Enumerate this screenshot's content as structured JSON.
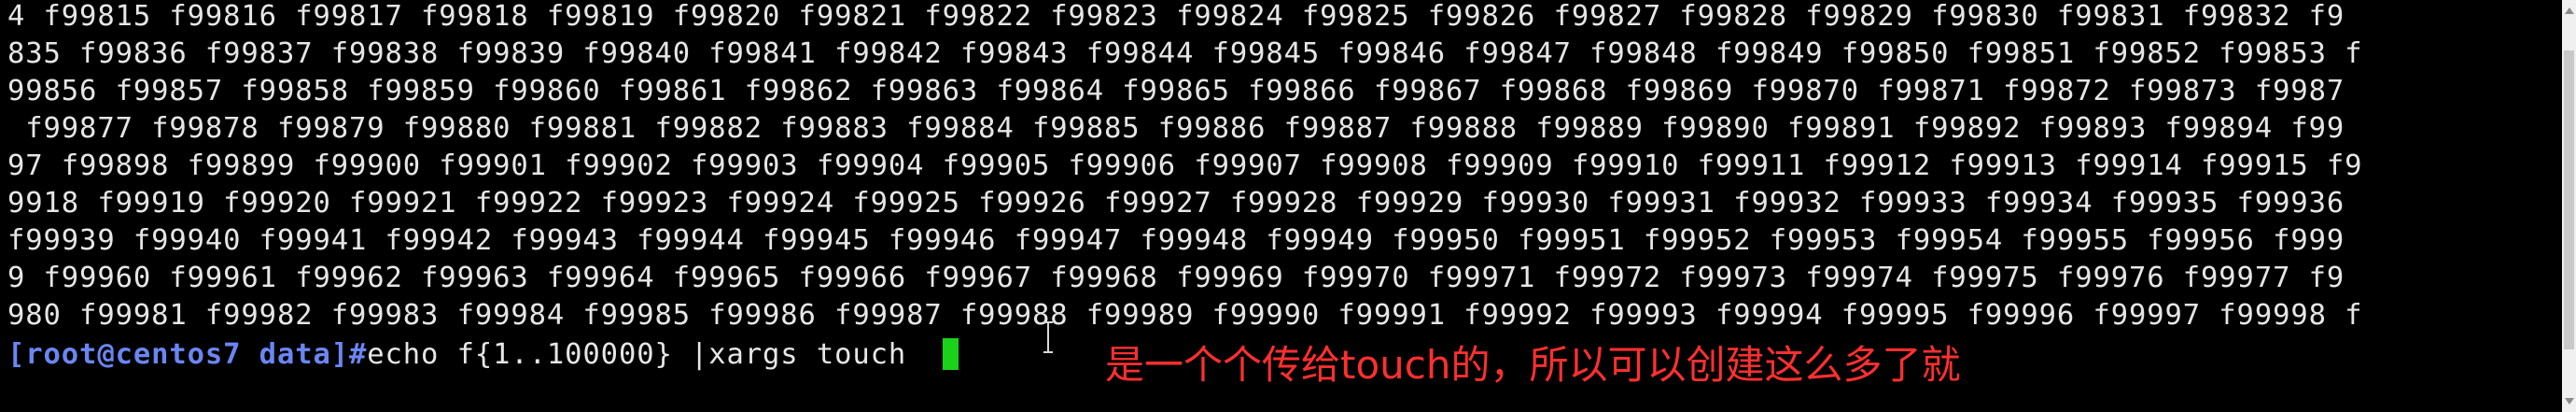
{
  "terminal": {
    "output_lines": [
      "4 f99815 f99816 f99817 f99818 f99819 f99820 f99821 f99822 f99823 f99824 f99825 f99826 f99827 f99828 f99829 f99830 f99831 f99832 f9",
      "835 f99836 f99837 f99838 f99839 f99840 f99841 f99842 f99843 f99844 f99845 f99846 f99847 f99848 f99849 f99850 f99851 f99852 f99853 f",
      "99856 f99857 f99858 f99859 f99860 f99861 f99862 f99863 f99864 f99865 f99866 f99867 f99868 f99869 f99870 f99871 f99872 f99873 f9987",
      " f99877 f99878 f99879 f99880 f99881 f99882 f99883 f99884 f99885 f99886 f99887 f99888 f99889 f99890 f99891 f99892 f99893 f99894 f99",
      "97 f99898 f99899 f99900 f99901 f99902 f99903 f99904 f99905 f99906 f99907 f99908 f99909 f99910 f99911 f99912 f99913 f99914 f99915 f9",
      "9918 f99919 f99920 f99921 f99922 f99923 f99924 f99925 f99926 f99927 f99928 f99929 f99930 f99931 f99932 f99933 f99934 f99935 f99936 ",
      "f99939 f99940 f99941 f99942 f99943 f99944 f99945 f99946 f99947 f99948 f99949 f99950 f99951 f99952 f99953 f99954 f99955 f99956 f999",
      "9 f99960 f99961 f99962 f99963 f99964 f99965 f99966 f99967 f99968 f99969 f99970 f99971 f99972 f99973 f99974 f99975 f99976 f99977 f9",
      "980 f99981 f99982 f99983 f99984 f99985 f99986 f99987 f99988 f99989 f99990 f99991 f99992 f99993 f99994 f99995 f99996 f99997 f99998 f"
    ],
    "prompt": {
      "user_host_dir": "[root@centos7 data]#",
      "command": "echo f{1..100000} |xargs touch "
    },
    "colors": {
      "background": "#000000",
      "text": "#e6e6e6",
      "prompt": "#6b86f2",
      "cursor": "#19d219",
      "annotation": "#ff2f2f"
    }
  },
  "annotation": {
    "text": "是一个个传给touch的，所以可以创建这么多了就"
  },
  "icons": {
    "mouse_pointer": "i-beam-cursor-icon",
    "scroll_up": "scroll-up-arrow-icon",
    "scroll_down": "scroll-down-arrow-icon"
  }
}
